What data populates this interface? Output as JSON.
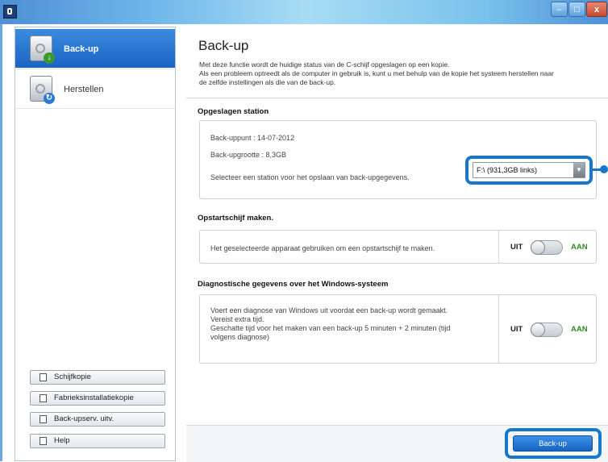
{
  "window": {
    "controls": {
      "minimize": "–",
      "maximize": "□",
      "close": "x"
    }
  },
  "sidebar": {
    "nav": [
      {
        "label": "Back-up",
        "icon": "backup-disk-icon",
        "active": true
      },
      {
        "label": "Herstellen",
        "icon": "restore-disk-icon",
        "active": false
      }
    ],
    "buttons": [
      {
        "label": "Schijfkopie",
        "icon": "disk-copy-icon"
      },
      {
        "label": "Fabrieksinstallatiekopie",
        "icon": "factory-image-icon"
      },
      {
        "label": "Back-upserv. uitv.",
        "icon": "backup-service-icon"
      },
      {
        "label": "Help",
        "icon": "help-icon"
      }
    ]
  },
  "main": {
    "title": "Back-up",
    "description": [
      "Met deze functie wordt de huidige status van de C-schijf opgeslagen op een kopie.",
      "Als een probleem optreedt als de computer in gebruik is, kunt u met behulp van de kopie het systeem herstellen naar",
      "de zelfde instellingen als die van de back-up."
    ],
    "stored_station": {
      "heading": "Opgeslagen station",
      "backup_point": "Back-uppunt : 14-07-2012",
      "backup_size": "Back-upgrootte : 8,3GB",
      "select_label": "Selecteer een station voor het opslaan van back-upgegevens.",
      "drive_value": "F:\\ (931,3GB links)"
    },
    "boot_disk": {
      "heading": "Opstartschijf maken.",
      "text": "Het geselecteerde apparaat gebruiken om een opstartschijf te maken.",
      "off_label": "UIT",
      "on_label": "AAN",
      "state": "off"
    },
    "diagnostics": {
      "heading": "Diagnostische gegevens over het Windows-systeem",
      "lines": [
        "Voert een diagnose van Windows uit voordat een back-up wordt gemaakt.",
        "Vereist extra tijd.",
        "Geschatte tijd voor het maken van een back-up 5 minuten + 2 minuten (tijd",
        "volgens diagnose)"
      ],
      "off_label": "UIT",
      "on_label": "AAN",
      "state": "off"
    },
    "primary_button": "Back-up"
  },
  "colors": {
    "accent": "#1a63c4",
    "highlight": "#1578cd",
    "on_green": "#2e8b1f"
  }
}
